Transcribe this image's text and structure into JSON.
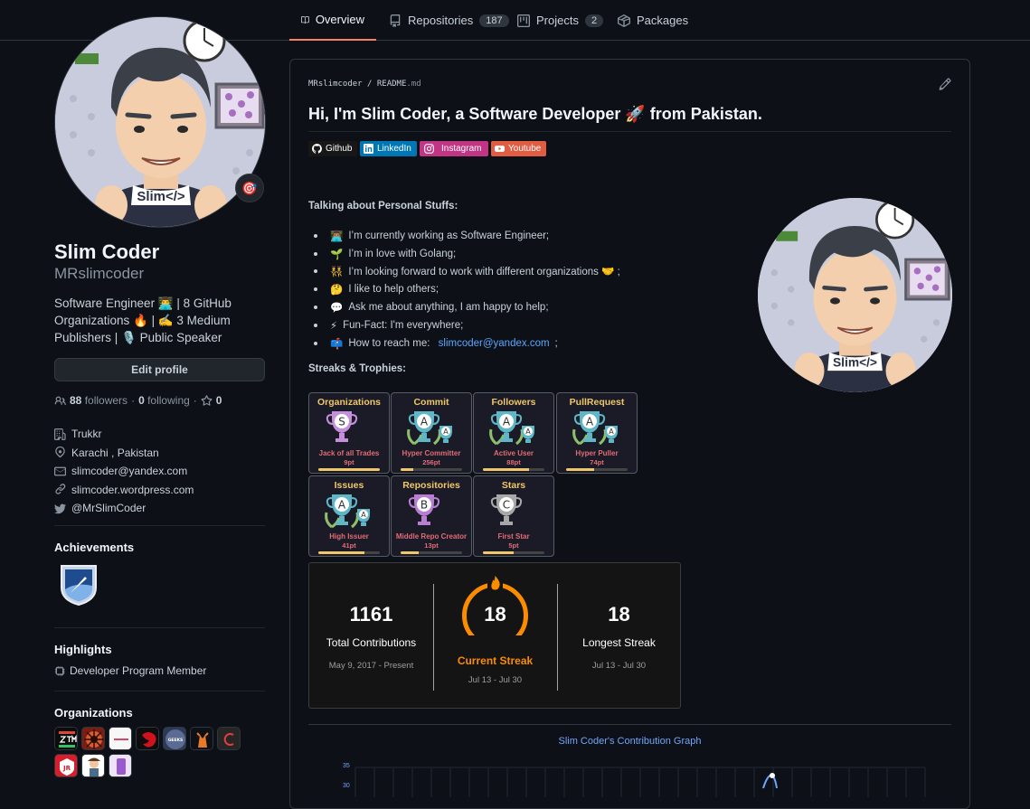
{
  "nav": {
    "tabs": [
      {
        "label": "Overview",
        "icon": "book-icon"
      },
      {
        "label": "Repositories",
        "icon": "repo-icon",
        "count": "187"
      },
      {
        "label": "Projects",
        "icon": "project-icon",
        "count": "2"
      },
      {
        "label": "Packages",
        "icon": "package-icon"
      }
    ]
  },
  "profile": {
    "name": "Slim Coder",
    "login": "MRslimcoder",
    "bio_line1": "Software Engineer 👨‍💻 | 8 GitHub",
    "bio_line2": "Organizations 🔥 | ✍️ 3 Medium",
    "bio_line3": "Publishers | 🎙️ Public Speaker",
    "edit_label": "Edit profile",
    "followers_count": "88",
    "followers_label": "followers",
    "following_count": "0",
    "following_label": "following",
    "stars_count": "0",
    "company": "Trukkr",
    "location": "Karachi , Pakistan",
    "email": "slimcoder@yandex.com",
    "website": "slimcoder.wordpress.com",
    "twitter": "@MrSlimCoder",
    "status_emoji": "🎯"
  },
  "sidebar": {
    "achievements_title": "Achievements",
    "highlights_title": "Highlights",
    "highlight_item": "Developer Program Member",
    "organizations_title": "Organizations"
  },
  "readme": {
    "owner": "MRslimcoder",
    "slash": "/",
    "file": "README",
    "ext": ".md",
    "heading": "Hi, I'm Slim Coder, a Software Developer 🚀 from Pakistan.",
    "badges": [
      {
        "label": "Github",
        "color": "#181717"
      },
      {
        "label": "LinkedIn",
        "color": "#0077b5"
      },
      {
        "label": "Instagram",
        "color": "#e4405f"
      },
      {
        "label": "Youtube",
        "color": "#ff0000"
      }
    ],
    "personal_title": "Talking about Personal Stuffs:",
    "items": [
      {
        "emoji": "👨🏽‍💻",
        "text": "I’m currently working as Software Engineer;"
      },
      {
        "emoji": "🌱",
        "text": "I’m in love with Golang;"
      },
      {
        "emoji": "👯",
        "text": "I’m looking forward to work with different organizations 🤝 ;"
      },
      {
        "emoji": "🤔",
        "text": "I like to help others;"
      },
      {
        "emoji": "💬",
        "text": "Ask me about anything, I am happy to help;"
      },
      {
        "emoji": "⚡",
        "text": "Fun-Fact: I'm everywhere;"
      },
      {
        "emoji": "📫",
        "text": "How to reach me: ",
        "link": "slimcoder@yandex.com",
        "tail": ";"
      }
    ],
    "trophies_title": "Streaks & Trophies:"
  },
  "trophies": [
    {
      "category": "Organizations",
      "rank": "S",
      "title": "Jack of all Trades",
      "points": "9pt",
      "progress": 1.0,
      "color": "#c58fdb"
    },
    {
      "category": "Commit",
      "rank": "A",
      "title": "Hyper Committer",
      "points": "256pt",
      "progress": 0.2,
      "color": "#5fb6c6"
    },
    {
      "category": "Followers",
      "rank": "A",
      "title": "Active User",
      "points": "88pt",
      "progress": 0.75,
      "color": "#5fb6c6"
    },
    {
      "category": "PullRequest",
      "rank": "A",
      "title": "Hyper Puller",
      "points": "74pt",
      "progress": 0.45,
      "color": "#5fb6c6"
    },
    {
      "category": "Issues",
      "rank": "A",
      "title": "High Issuer",
      "points": "41pt",
      "progress": 0.75,
      "color": "#5fb6c6"
    },
    {
      "category": "Repositories",
      "rank": "B",
      "title": "Middle Repo Creator",
      "points": "13pt",
      "progress": 0.3,
      "color": "#b77ed1"
    },
    {
      "category": "Stars",
      "rank": "C",
      "title": "First Star",
      "points": "5pt",
      "progress": 0.5,
      "color": "#a8a8a8"
    }
  ],
  "streak": {
    "total": "1161",
    "total_label": "Total Contributions",
    "total_range": "May 9, 2017 - Present",
    "current": "18",
    "current_label": "Current Streak",
    "current_range": "Jul 13 - Jul 30",
    "longest": "18",
    "longest_label": "Longest Streak",
    "longest_range": "Jul 13 - Jul 30"
  },
  "graph": {
    "title": "Slim Coder's Contribution Graph",
    "y_ticks": [
      "35",
      "30"
    ]
  }
}
